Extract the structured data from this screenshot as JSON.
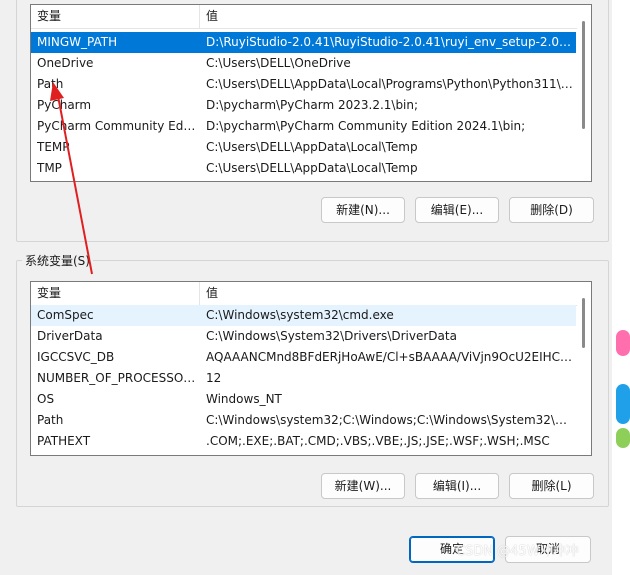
{
  "user_vars": {
    "header_name": "变量",
    "header_value": "值",
    "rows": [
      {
        "name": "MINGW_PATH",
        "value": "D:\\RuyiStudio-2.0.41\\RuyiStudio-2.0.41\\ruyi_env_setup-2.0.41\\..."
      },
      {
        "name": "OneDrive",
        "value": "C:\\Users\\DELL\\OneDrive"
      },
      {
        "name": "Path",
        "value": "C:\\Users\\DELL\\AppData\\Local\\Programs\\Python\\Python311\\S..."
      },
      {
        "name": "PyCharm",
        "value": "D:\\pycharm\\PyCharm 2023.2.1\\bin;"
      },
      {
        "name": "PyCharm Community Editi...",
        "value": "D:\\pycharm\\PyCharm Community Edition 2024.1\\bin;"
      },
      {
        "name": "TEMP",
        "value": "C:\\Users\\DELL\\AppData\\Local\\Temp"
      },
      {
        "name": "TMP",
        "value": "C:\\Users\\DELL\\AppData\\Local\\Temp"
      }
    ],
    "buttons": {
      "new": "新建(N)...",
      "edit": "编辑(E)...",
      "delete": "删除(D)"
    }
  },
  "system_vars": {
    "group_title": "系统变量(S)",
    "header_name": "变量",
    "header_value": "值",
    "rows": [
      {
        "name": "ComSpec",
        "value": "C:\\Windows\\system32\\cmd.exe"
      },
      {
        "name": "DriverData",
        "value": "C:\\Windows\\System32\\Drivers\\DriverData"
      },
      {
        "name": "IGCCSVC_DB",
        "value": "AQAAANCMnd8BFdERjHoAwE/Cl+sBAAAA/ViVjn9OcU2EIHCl..."
      },
      {
        "name": "NUMBER_OF_PROCESSORS",
        "value": "12"
      },
      {
        "name": "OS",
        "value": "Windows_NT"
      },
      {
        "name": "Path",
        "value": "C:\\Windows\\system32;C:\\Windows;C:\\Windows\\System32\\Wb..."
      },
      {
        "name": "PATHEXT",
        "value": ".COM;.EXE;.BAT;.CMD;.VBS;.VBE;.JS;.JSE;.WSF;.WSH;.MSC"
      }
    ],
    "buttons": {
      "new": "新建(W)...",
      "edit": "编辑(I)...",
      "delete": "删除(L)"
    }
  },
  "dialog_buttons": {
    "ok": "确定",
    "cancel": "取消"
  },
  "watermark": "CSDN @45W冲冲冲",
  "annotation_color": "#e02020"
}
